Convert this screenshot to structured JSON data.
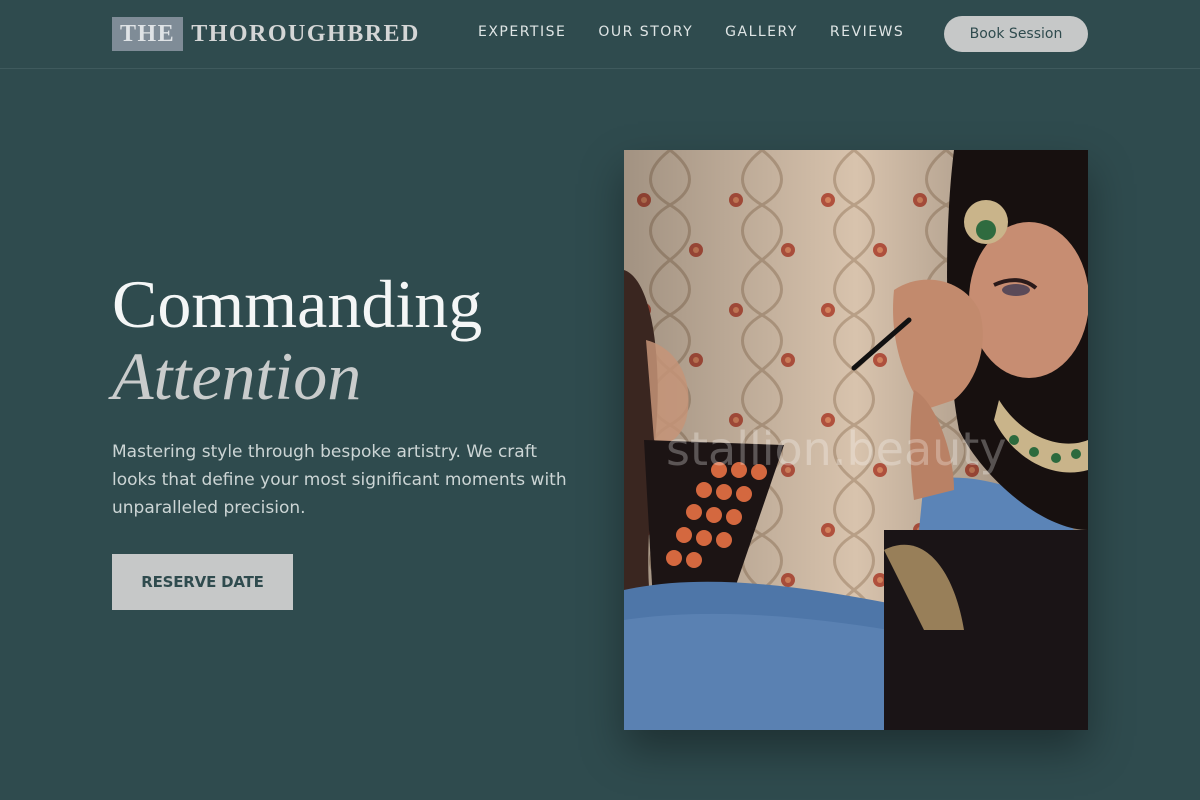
{
  "brand": {
    "logo_box": "THE",
    "logo_rest": "THOROUGHBRED"
  },
  "nav": {
    "links": [
      "EXPERTISE",
      "OUR STORY",
      "GALLERY",
      "REVIEWS"
    ],
    "cta": "Book Session"
  },
  "hero": {
    "title_line1": "Commanding",
    "title_line2": "Attention",
    "description": "Mastering style through bespoke artistry. We craft looks that define your most significant moments with unparalleled precision.",
    "button": "RESERVE DATE"
  },
  "photo": {
    "watermark": "stallion.beauty",
    "subject": "makeup-artist-applying-bridal-makeup"
  },
  "colors": {
    "background": "#2f4b4e",
    "button_bg": "#c6c8c8",
    "button_text": "#2f4b4e"
  }
}
